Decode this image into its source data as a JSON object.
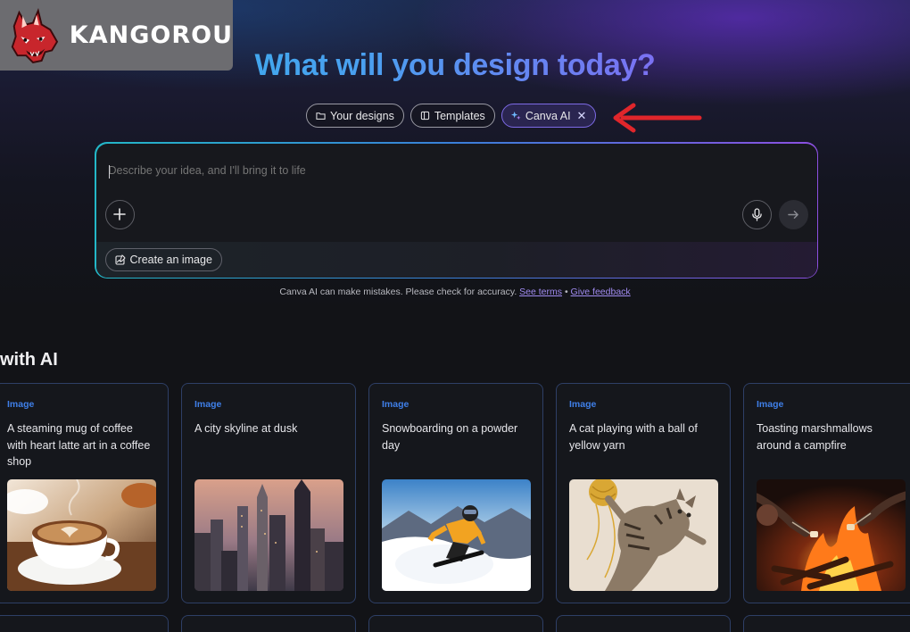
{
  "brand": {
    "name": "KANGOROU"
  },
  "headline": "What will you design today?",
  "tabs": [
    {
      "label": "Your designs",
      "icon": "folder-icon"
    },
    {
      "label": "Templates",
      "icon": "template-icon"
    },
    {
      "label": "Canva AI",
      "icon": "sparkle-icon",
      "close": "✕"
    }
  ],
  "prompt": {
    "placeholder": "Describe your idea, and I'll bring it to life",
    "chip_label": "Create an image"
  },
  "disclaimer": {
    "text": "Canva AI can make mistakes. Please check for accuracy.",
    "see_terms": "See terms",
    "separator": "•",
    "give_feedback": "Give feedback"
  },
  "section_title": "with AI",
  "cards": [
    {
      "tag": "Image",
      "text": "A steaming mug of coffee with heart latte art in a coffee shop"
    },
    {
      "tag": "Image",
      "text": "A city skyline at dusk"
    },
    {
      "tag": "Image",
      "text": "Snowboarding on a powder day"
    },
    {
      "tag": "Image",
      "text": "A cat playing with a ball of yellow yarn"
    },
    {
      "tag": "Image",
      "text": "Toasting marshmallows around a campfire"
    }
  ],
  "colors": {
    "accent_purple": "#7d6ae6",
    "link": "#a08bf0",
    "tag_blue": "#3f7fe8",
    "annotation_arrow": "#e0262b"
  }
}
